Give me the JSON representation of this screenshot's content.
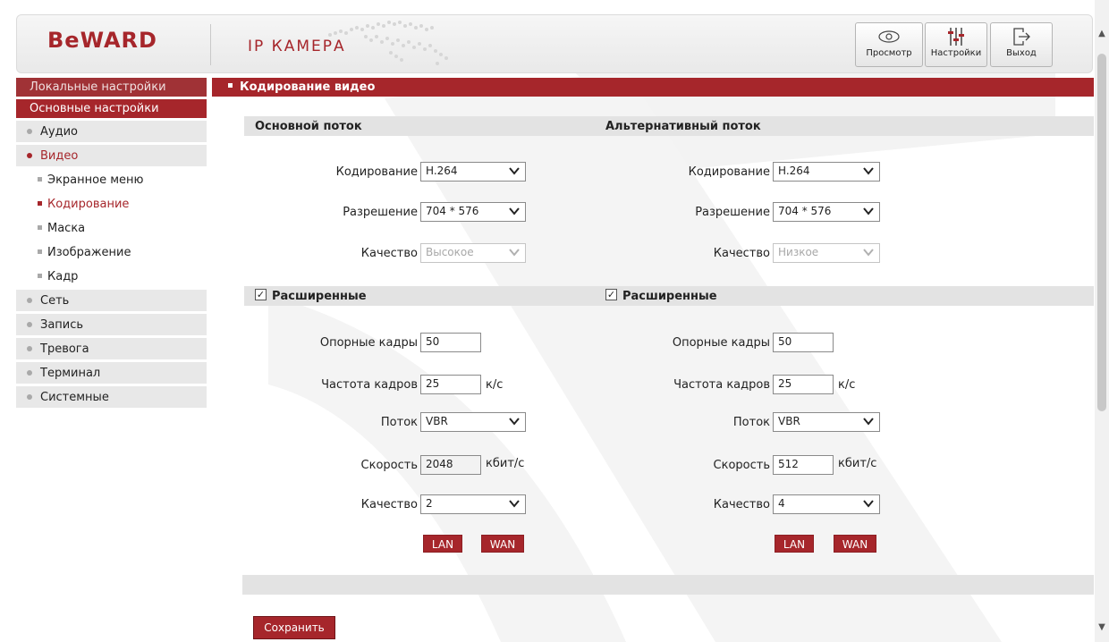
{
  "header": {
    "logo": "BeWARD",
    "product": "IP КАМЕРА",
    "buttons": {
      "view": "Просмотр",
      "settings": "Настройки",
      "exit": "Выход"
    }
  },
  "sidebar": {
    "local": "Локальные настройки",
    "basic": "Основные настройки",
    "items": {
      "audio": "Аудио",
      "video": "Видео",
      "osd": "Экранное меню",
      "encoding": "Кодирование",
      "mask": "Маска",
      "image": "Изображение",
      "frame": "Кадр",
      "network": "Сеть",
      "record": "Запись",
      "alarm": "Тревога",
      "terminal": "Терминал",
      "system": "Системные"
    }
  },
  "page_title": "Кодирование видео",
  "main_stream": {
    "title": "Основной поток",
    "encoding_label": "Кодирование",
    "encoding_value": "H.264",
    "resolution_label": "Разрешение",
    "resolution_value": "704 * 576",
    "quality_label": "Качество",
    "quality_value": "Высокое",
    "advanced_label": "Расширенные",
    "advanced_checked": true,
    "keyframe_label": "Опорные кадры",
    "keyframe_value": "50",
    "framerate_label": "Частота кадров",
    "framerate_value": "25",
    "framerate_unit": "к/с",
    "stream_label": "Поток",
    "stream_value": "VBR",
    "bitrate_label": "Скорость",
    "bitrate_value": "2048",
    "bitrate_unit": "кбит/с",
    "adv_quality_label": "Качество",
    "adv_quality_value": "2",
    "lan": "LAN",
    "wan": "WAN"
  },
  "alt_stream": {
    "title": "Альтернативный поток",
    "encoding_label": "Кодирование",
    "encoding_value": "H.264",
    "resolution_label": "Разрешение",
    "resolution_value": "704 * 576",
    "quality_label": "Качество",
    "quality_value": "Низкое",
    "advanced_label": "Расширенные",
    "advanced_checked": true,
    "keyframe_label": "Опорные кадры",
    "keyframe_value": "50",
    "framerate_label": "Частота кадров",
    "framerate_value": "25",
    "framerate_unit": "к/с",
    "stream_label": "Поток",
    "stream_value": "VBR",
    "bitrate_label": "Скорость",
    "bitrate_value": "512",
    "bitrate_unit": "кбит/с",
    "adv_quality_label": "Качество",
    "adv_quality_value": "4",
    "lan": "LAN",
    "wan": "WAN"
  },
  "save_button": "Сохранить",
  "colors": {
    "brand": "#a6262b",
    "section_bg": "#e3e3e3",
    "sidebar_item_bg": "#e8e8e8"
  }
}
